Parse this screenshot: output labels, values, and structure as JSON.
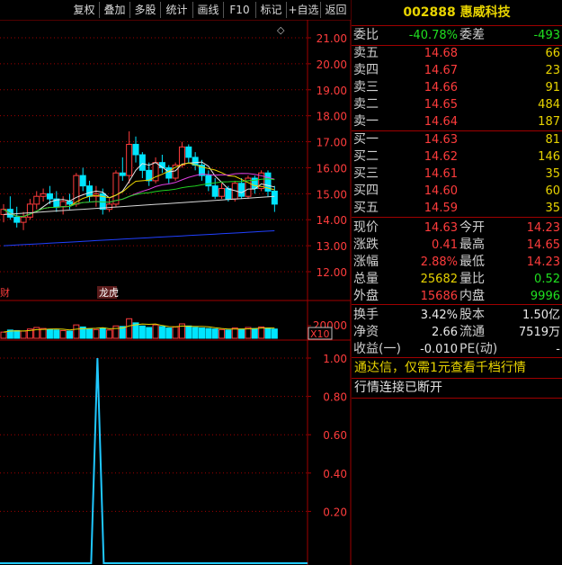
{
  "toolbar": {
    "buttons": [
      "复权",
      "叠加",
      "多股",
      "统计",
      "画线",
      "F10",
      "标记",
      "+自选",
      "返回"
    ]
  },
  "chart": {
    "diamond_icon": "◇",
    "price_ticks": [
      "21.00",
      "20.00",
      "19.00",
      "18.00",
      "17.00",
      "16.00",
      "15.00",
      "14.00",
      "13.00",
      "12.00"
    ],
    "volume_tick": "20000",
    "volume_unit": "X10",
    "indicator_ticks": [
      "1.00",
      "0.80",
      "0.60",
      "0.40",
      "0.20"
    ],
    "tags": {
      "left_tag": "财",
      "dragon_tag": "龙虎"
    }
  },
  "chart_data": {
    "type": "candlestick",
    "price_axis": {
      "min": 12,
      "max": 21
    },
    "candles": [
      {
        "o": 14.2,
        "h": 14.6,
        "l": 13.9,
        "c": 14.4
      },
      {
        "o": 14.4,
        "h": 14.9,
        "l": 14.0,
        "c": 14.1
      },
      {
        "o": 14.1,
        "h": 14.5,
        "l": 13.7,
        "c": 13.9
      },
      {
        "o": 13.9,
        "h": 14.3,
        "l": 13.6,
        "c": 14.1
      },
      {
        "o": 14.1,
        "h": 14.8,
        "l": 14.0,
        "c": 14.6
      },
      {
        "o": 14.6,
        "h": 15.1,
        "l": 14.4,
        "c": 14.9
      },
      {
        "o": 14.9,
        "h": 15.2,
        "l": 14.7,
        "c": 15.0
      },
      {
        "o": 15.0,
        "h": 15.3,
        "l": 14.6,
        "c": 14.8
      },
      {
        "o": 14.8,
        "h": 15.1,
        "l": 14.3,
        "c": 14.5
      },
      {
        "o": 14.5,
        "h": 14.9,
        "l": 14.2,
        "c": 14.7
      },
      {
        "o": 14.7,
        "h": 15.0,
        "l": 14.4,
        "c": 14.6
      },
      {
        "o": 14.6,
        "h": 15.8,
        "l": 14.5,
        "c": 15.7
      },
      {
        "o": 15.7,
        "h": 16.0,
        "l": 15.1,
        "c": 15.3
      },
      {
        "o": 15.3,
        "h": 15.5,
        "l": 14.7,
        "c": 14.9
      },
      {
        "o": 14.9,
        "h": 15.3,
        "l": 14.5,
        "c": 15.0
      },
      {
        "o": 15.0,
        "h": 15.2,
        "l": 14.2,
        "c": 14.4
      },
      {
        "o": 14.4,
        "h": 14.8,
        "l": 14.3,
        "c": 14.6
      },
      {
        "o": 14.6,
        "h": 15.9,
        "l": 14.5,
        "c": 15.8
      },
      {
        "o": 15.8,
        "h": 16.4,
        "l": 15.5,
        "c": 15.7
      },
      {
        "o": 15.7,
        "h": 17.4,
        "l": 15.4,
        "c": 16.9
      },
      {
        "o": 16.9,
        "h": 17.2,
        "l": 16.2,
        "c": 16.5
      },
      {
        "o": 16.5,
        "h": 16.6,
        "l": 15.6,
        "c": 15.9
      },
      {
        "o": 15.9,
        "h": 16.2,
        "l": 15.3,
        "c": 15.5
      },
      {
        "o": 15.5,
        "h": 16.4,
        "l": 15.4,
        "c": 16.2
      },
      {
        "o": 16.2,
        "h": 16.5,
        "l": 15.8,
        "c": 16.0
      },
      {
        "o": 16.0,
        "h": 16.1,
        "l": 15.4,
        "c": 15.6
      },
      {
        "o": 15.6,
        "h": 16.2,
        "l": 15.5,
        "c": 16.1
      },
      {
        "o": 16.1,
        "h": 17.0,
        "l": 16.0,
        "c": 16.8
      },
      {
        "o": 16.8,
        "h": 16.9,
        "l": 16.2,
        "c": 16.4
      },
      {
        "o": 16.4,
        "h": 16.6,
        "l": 15.9,
        "c": 16.1
      },
      {
        "o": 16.1,
        "h": 16.3,
        "l": 15.5,
        "c": 15.7
      },
      {
        "o": 15.7,
        "h": 15.9,
        "l": 15.1,
        "c": 15.3
      },
      {
        "o": 15.3,
        "h": 15.6,
        "l": 14.8,
        "c": 14.9
      },
      {
        "o": 14.9,
        "h": 15.4,
        "l": 14.8,
        "c": 15.2
      },
      {
        "o": 15.2,
        "h": 15.3,
        "l": 14.7,
        "c": 14.8
      },
      {
        "o": 14.8,
        "h": 15.5,
        "l": 14.7,
        "c": 15.4
      },
      {
        "o": 15.4,
        "h": 15.6,
        "l": 14.8,
        "c": 14.9
      },
      {
        "o": 14.9,
        "h": 15.7,
        "l": 14.8,
        "c": 15.6
      },
      {
        "o": 15.6,
        "h": 15.7,
        "l": 15.0,
        "c": 15.2
      },
      {
        "o": 15.2,
        "h": 15.9,
        "l": 15.1,
        "c": 15.8
      },
      {
        "o": 15.8,
        "h": 15.9,
        "l": 14.9,
        "c": 15.1
      },
      {
        "o": 15.1,
        "h": 15.3,
        "l": 14.3,
        "c": 14.6
      }
    ],
    "volumes": [
      120,
      160,
      150,
      140,
      180,
      210,
      190,
      170,
      160,
      150,
      140,
      260,
      220,
      180,
      170,
      200,
      160,
      240,
      230,
      380,
      300,
      240,
      210,
      260,
      230,
      200,
      220,
      280,
      240,
      210,
      200,
      190,
      180,
      170,
      160,
      200,
      180,
      210,
      190,
      220,
      200,
      180
    ],
    "indicator": {
      "min": 0,
      "max": 1.05,
      "spike_value": 1.0
    }
  },
  "quote": {
    "code": "002888",
    "name": "惠威科技",
    "weibi_label": "委比",
    "weibi_value": "-40.78%",
    "weicha_label": "委差",
    "weicha_value": "-493",
    "sells": [
      {
        "label": "卖五",
        "price": "14.68",
        "vol": "66"
      },
      {
        "label": "卖四",
        "price": "14.67",
        "vol": "23"
      },
      {
        "label": "卖三",
        "price": "14.66",
        "vol": "91"
      },
      {
        "label": "卖二",
        "price": "14.65",
        "vol": "484"
      },
      {
        "label": "卖一",
        "price": "14.64",
        "vol": "187"
      }
    ],
    "buys": [
      {
        "label": "买一",
        "price": "14.63",
        "vol": "81"
      },
      {
        "label": "买二",
        "price": "14.62",
        "vol": "146"
      },
      {
        "label": "买三",
        "price": "14.61",
        "vol": "35"
      },
      {
        "label": "买四",
        "price": "14.60",
        "vol": "60"
      },
      {
        "label": "买五",
        "price": "14.59",
        "vol": "35"
      }
    ],
    "stats": [
      {
        "l1": "现价",
        "v1": "14.63",
        "c1": "red",
        "l2": "今开",
        "v2": "14.23",
        "c2": "red"
      },
      {
        "l1": "涨跌",
        "v1": "0.41",
        "c1": "red",
        "l2": "最高",
        "v2": "14.65",
        "c2": "red"
      },
      {
        "l1": "涨幅",
        "v1": "2.88%",
        "c1": "red",
        "l2": "最低",
        "v2": "14.23",
        "c2": "red"
      },
      {
        "l1": "总量",
        "v1": "25682",
        "c1": "yellow",
        "l2": "量比",
        "v2": "0.52",
        "c2": "green"
      },
      {
        "l1": "外盘",
        "v1": "15686",
        "c1": "red",
        "l2": "内盘",
        "v2": "9996",
        "c2": "green"
      }
    ],
    "fund": [
      {
        "l1": "换手",
        "v1": "3.42%",
        "l2": "股本",
        "v2": "1.50亿"
      },
      {
        "l1": "净资",
        "v1": "2.66",
        "l2": "流通",
        "v2": "7519万"
      },
      {
        "l1": "收益(一)",
        "v1": "-0.010",
        "l2": "PE(动)",
        "v2": "-"
      }
    ],
    "ad_text": "通达信，仅需1元查看千档行情",
    "status_text": "行情连接已断开"
  },
  "colors": {
    "up": "#ff3c3c",
    "down": "#00e5ff",
    "grid": "#a00000",
    "ma_white": "#e8e8e8",
    "ma_yellow": "#e8d400",
    "ma_magenta": "#e040e0",
    "ma_green": "#20d020",
    "ma_blue": "#2040ff",
    "indicator_line": "#20c8ff"
  }
}
